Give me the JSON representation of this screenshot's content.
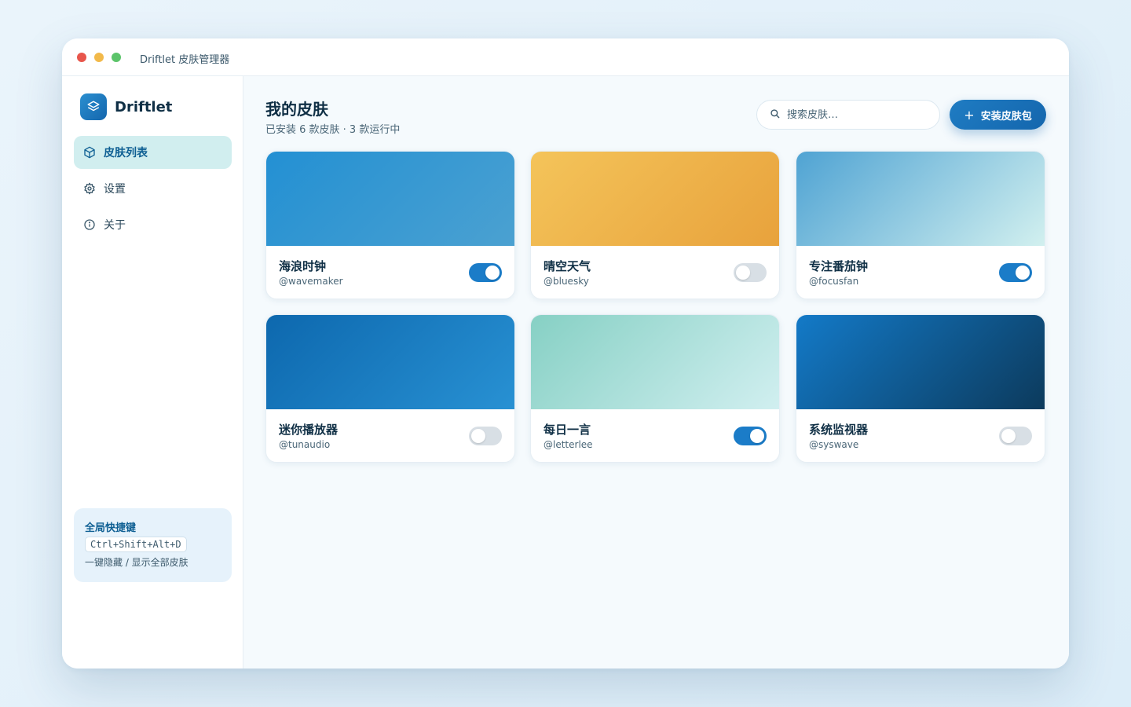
{
  "window": {
    "title": "Driftlet 皮肤管理器"
  },
  "sidebar": {
    "brand": "Driftlet",
    "items": [
      {
        "label": "皮肤列表",
        "icon": "cube-icon",
        "active": true
      },
      {
        "label": "设置",
        "icon": "gear-icon",
        "active": false
      },
      {
        "label": "关于",
        "icon": "info-icon",
        "active": false
      }
    ],
    "shortcut": {
      "title": "全局快捷键",
      "key": "Ctrl+Shift+Alt+D",
      "desc": "一键隐藏 / 显示全部皮肤"
    }
  },
  "main": {
    "title": "我的皮肤",
    "subtitle": "已安装 6 款皮肤 · 3 款运行中",
    "search": {
      "placeholder": "搜索皮肤…"
    },
    "install_label": "安装皮肤包",
    "skins": [
      {
        "name": "海浪时钟",
        "author": "@wavemaker",
        "enabled": true,
        "colors": [
          "#2390d3",
          "#4ba1d1"
        ]
      },
      {
        "name": "晴空天气",
        "author": "@bluesky",
        "enabled": false,
        "colors": [
          "#f4c45a",
          "#e8a23c"
        ]
      },
      {
        "name": "专注番茄钟",
        "author": "@focusfan",
        "enabled": true,
        "colors": [
          "#4fa3d3",
          "#d2f0ef"
        ]
      },
      {
        "name": "迷你播放器",
        "author": "@tunaudio",
        "enabled": false,
        "colors": [
          "#0d68ae",
          "#2891d3"
        ]
      },
      {
        "name": "每日一言",
        "author": "@letterlee",
        "enabled": true,
        "colors": [
          "#86d0c4",
          "#d1eff0"
        ]
      },
      {
        "name": "系统监视器",
        "author": "@syswave",
        "enabled": false,
        "colors": [
          "#137ac8",
          "#0c3a5c"
        ]
      }
    ]
  }
}
